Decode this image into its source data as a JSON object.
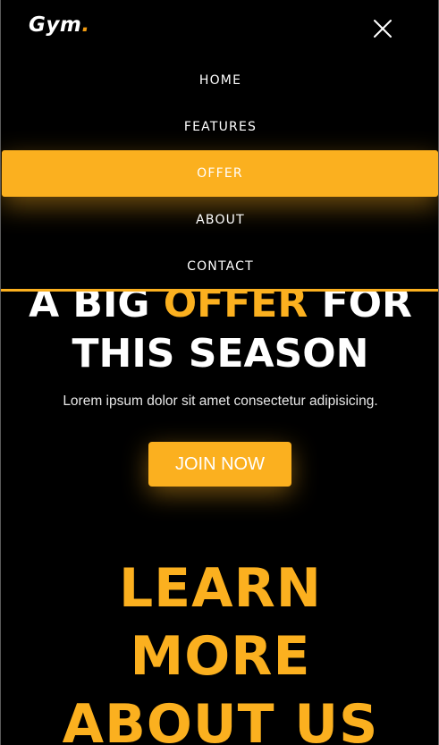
{
  "header": {
    "logo_text": "Gym",
    "logo_dot": ".",
    "close_icon": "close-icon"
  },
  "nav": {
    "items": [
      {
        "label": "HOME",
        "active": false
      },
      {
        "label": "FEATURES",
        "active": false
      },
      {
        "label": "OFFER",
        "active": true
      },
      {
        "label": "ABOUT",
        "active": false
      },
      {
        "label": "CONTACT",
        "active": false
      }
    ]
  },
  "hero": {
    "title_part1": "A BIG ",
    "title_accent": "OFFER",
    "title_part2": " FOR",
    "title_line2": "THIS SEASON",
    "subtitle": "Lorem ipsum dolor sit amet consectetur adipisicing.",
    "cta_label": "JOIN NOW"
  },
  "learn_more": {
    "line1": "LEARN",
    "line2": "MORE",
    "line3": "ABOUT US"
  },
  "colors": {
    "accent": "#fbb01f",
    "background": "#000000",
    "text": "#ffffff"
  }
}
